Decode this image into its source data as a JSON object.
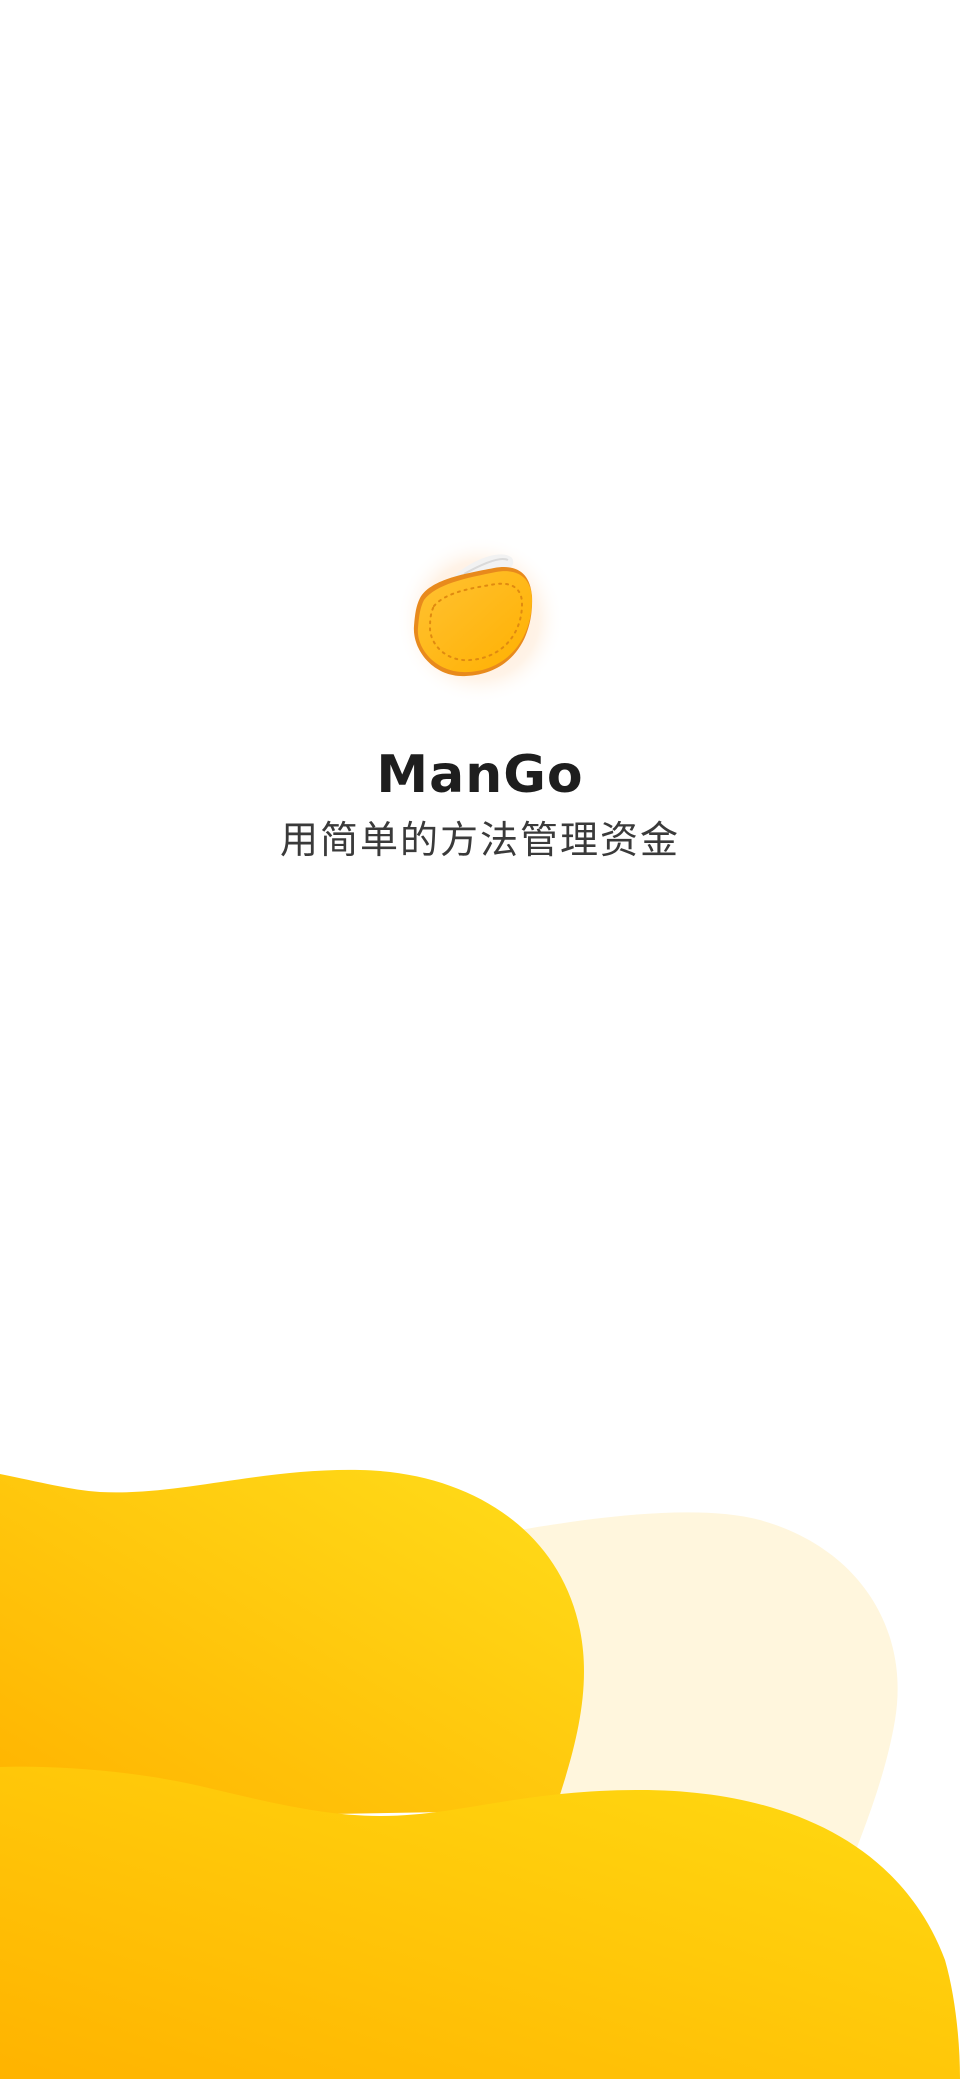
{
  "app": {
    "name": "ManGo",
    "tagline": "用简单的方法管理资金",
    "logo_icon": "wallet-icon"
  },
  "colors": {
    "background": "#ffffff",
    "brand_yellow": "#FFD21A",
    "brand_orange": "#FFB300",
    "pale_yellow": "#FFF6DD"
  }
}
